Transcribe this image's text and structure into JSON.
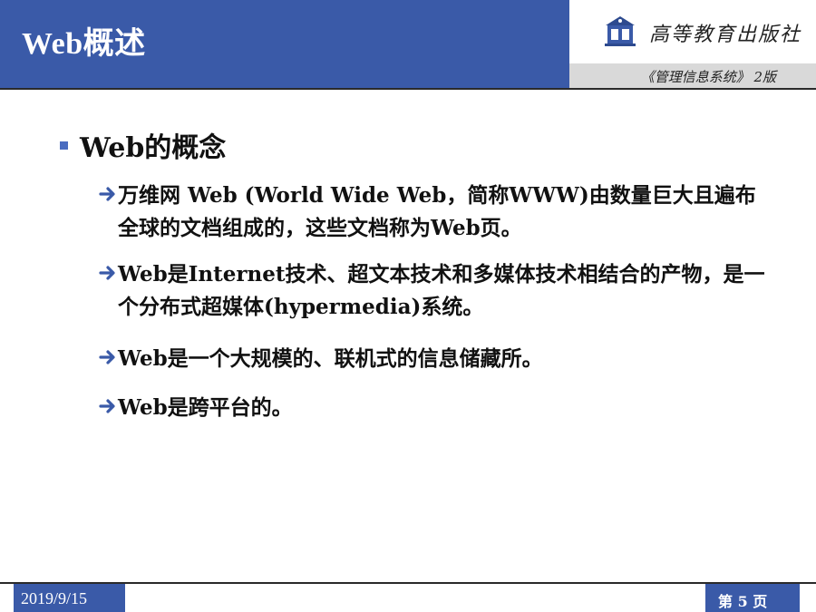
{
  "header": {
    "title": "Web概述",
    "publisher": "高等教育出版社",
    "course": "《管理信息系统》 2版"
  },
  "content": {
    "heading": "Web的概念",
    "items": [
      {
        "text": "万维网 Web (World Wide Web，简称WWW)由数量巨大且遍布全球的文档组成的，这些文档称为Web页。"
      },
      {
        "text": "Web是Internet技术、超文本技术和多媒体技术相结合的产物，是一个分布式超媒体(hypermedia)系统。"
      },
      {
        "text": "Web是一个大规模的、联机式的信息储藏所。"
      },
      {
        "text": "Web是跨平台的。"
      }
    ]
  },
  "footer": {
    "date": "2019/9/15",
    "page": "第 5 页"
  },
  "colors": {
    "accent": "#3a5aa8",
    "bullet": "#4a6cc0",
    "arrow": "#3a5aa8"
  },
  "icons": {
    "bullet": "square-bullet-icon",
    "sub_bullet": "arrow-right-icon",
    "logo": "publisher-logo-icon"
  }
}
